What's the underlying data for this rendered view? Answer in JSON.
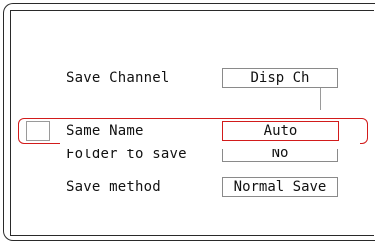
{
  "settings": {
    "rows": [
      {
        "label": "Save Channel",
        "value": "Disp Ch"
      },
      {
        "label": "Same Name",
        "value": "Auto"
      },
      {
        "label": "Folder to save",
        "value": "No"
      },
      {
        "label": "Save method",
        "value": "Normal Save"
      }
    ]
  },
  "colors": {
    "highlight": "#d21b1b",
    "box_border": "#8a8a8a"
  }
}
